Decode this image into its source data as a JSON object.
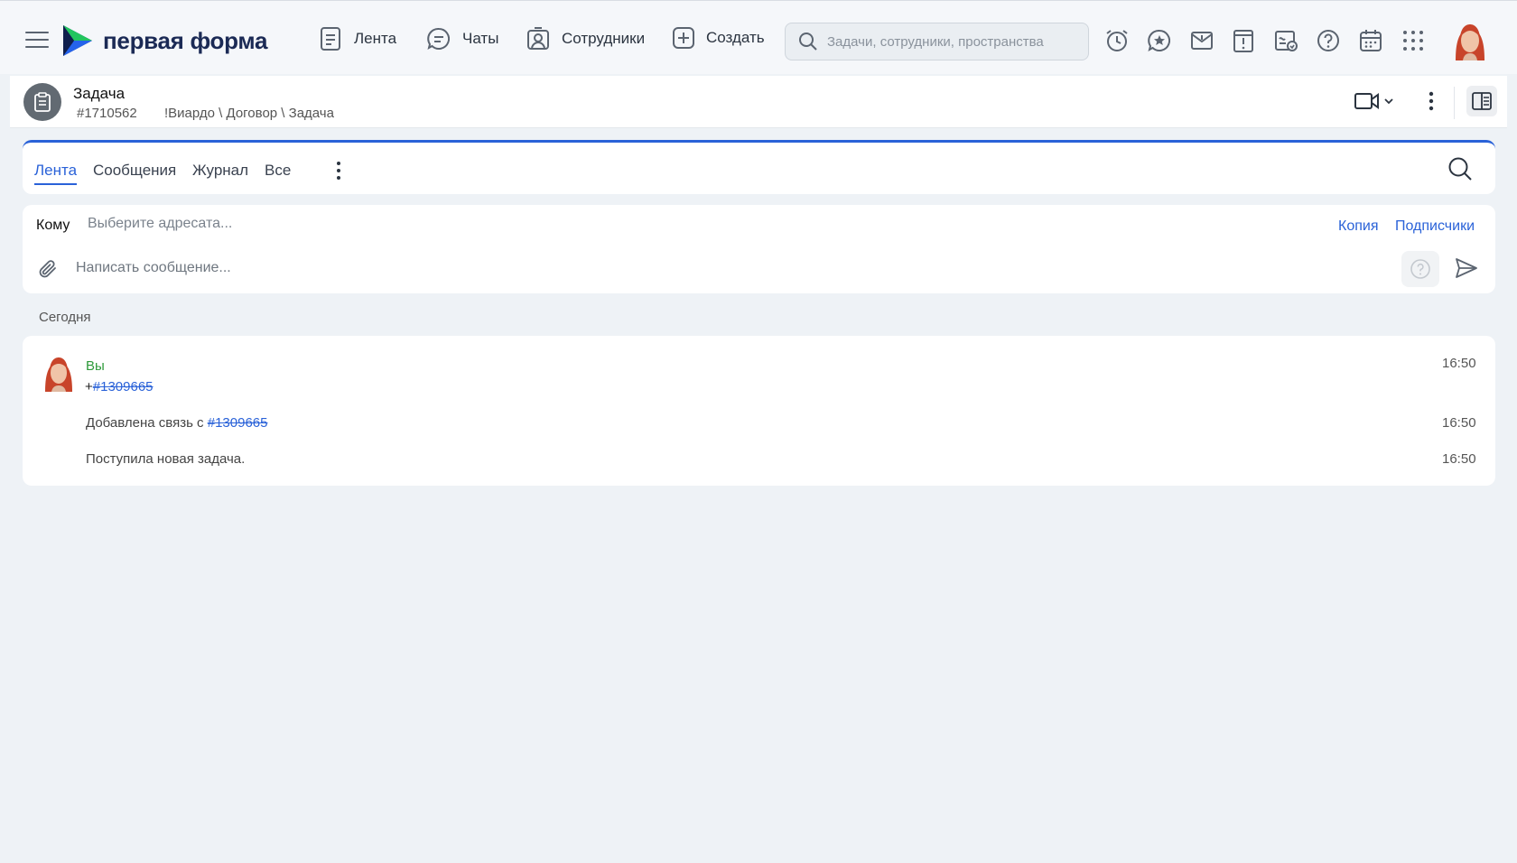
{
  "app": {
    "logo_text": "первая форма"
  },
  "nav": [
    {
      "label": "Лента"
    },
    {
      "label": "Чаты"
    },
    {
      "label": "Сотрудники"
    },
    {
      "label": "Создать"
    }
  ],
  "search": {
    "placeholder": "Задачи, сотрудники, пространства"
  },
  "task": {
    "title": "Задача",
    "number": "#1710562",
    "path": "!Виардо \\ Договор \\ Задача"
  },
  "tabs": [
    {
      "label": "Лента",
      "active": true
    },
    {
      "label": "Сообщения"
    },
    {
      "label": "Журнал"
    },
    {
      "label": "Все"
    }
  ],
  "compose": {
    "to_label": "Кому",
    "to_placeholder": "Выберите адресата...",
    "copy_label": "Копия",
    "subscribers_label": "Подписчики",
    "message_placeholder": "Написать сообщение..."
  },
  "feed": {
    "day_label": "Сегодня",
    "author": "Вы",
    "line1_prefix": "+",
    "line1_ref": "#1309665",
    "line1_time": "16:50",
    "line2_text": "Добавлена связь с ",
    "line2_ref": "#1309665",
    "line2_time": "16:50",
    "line3_text": "Поступила новая задача.",
    "line3_time": "16:50"
  },
  "colors": {
    "accent": "#2a62d8",
    "author": "#2e9a3a",
    "background": "#eef2f6"
  }
}
